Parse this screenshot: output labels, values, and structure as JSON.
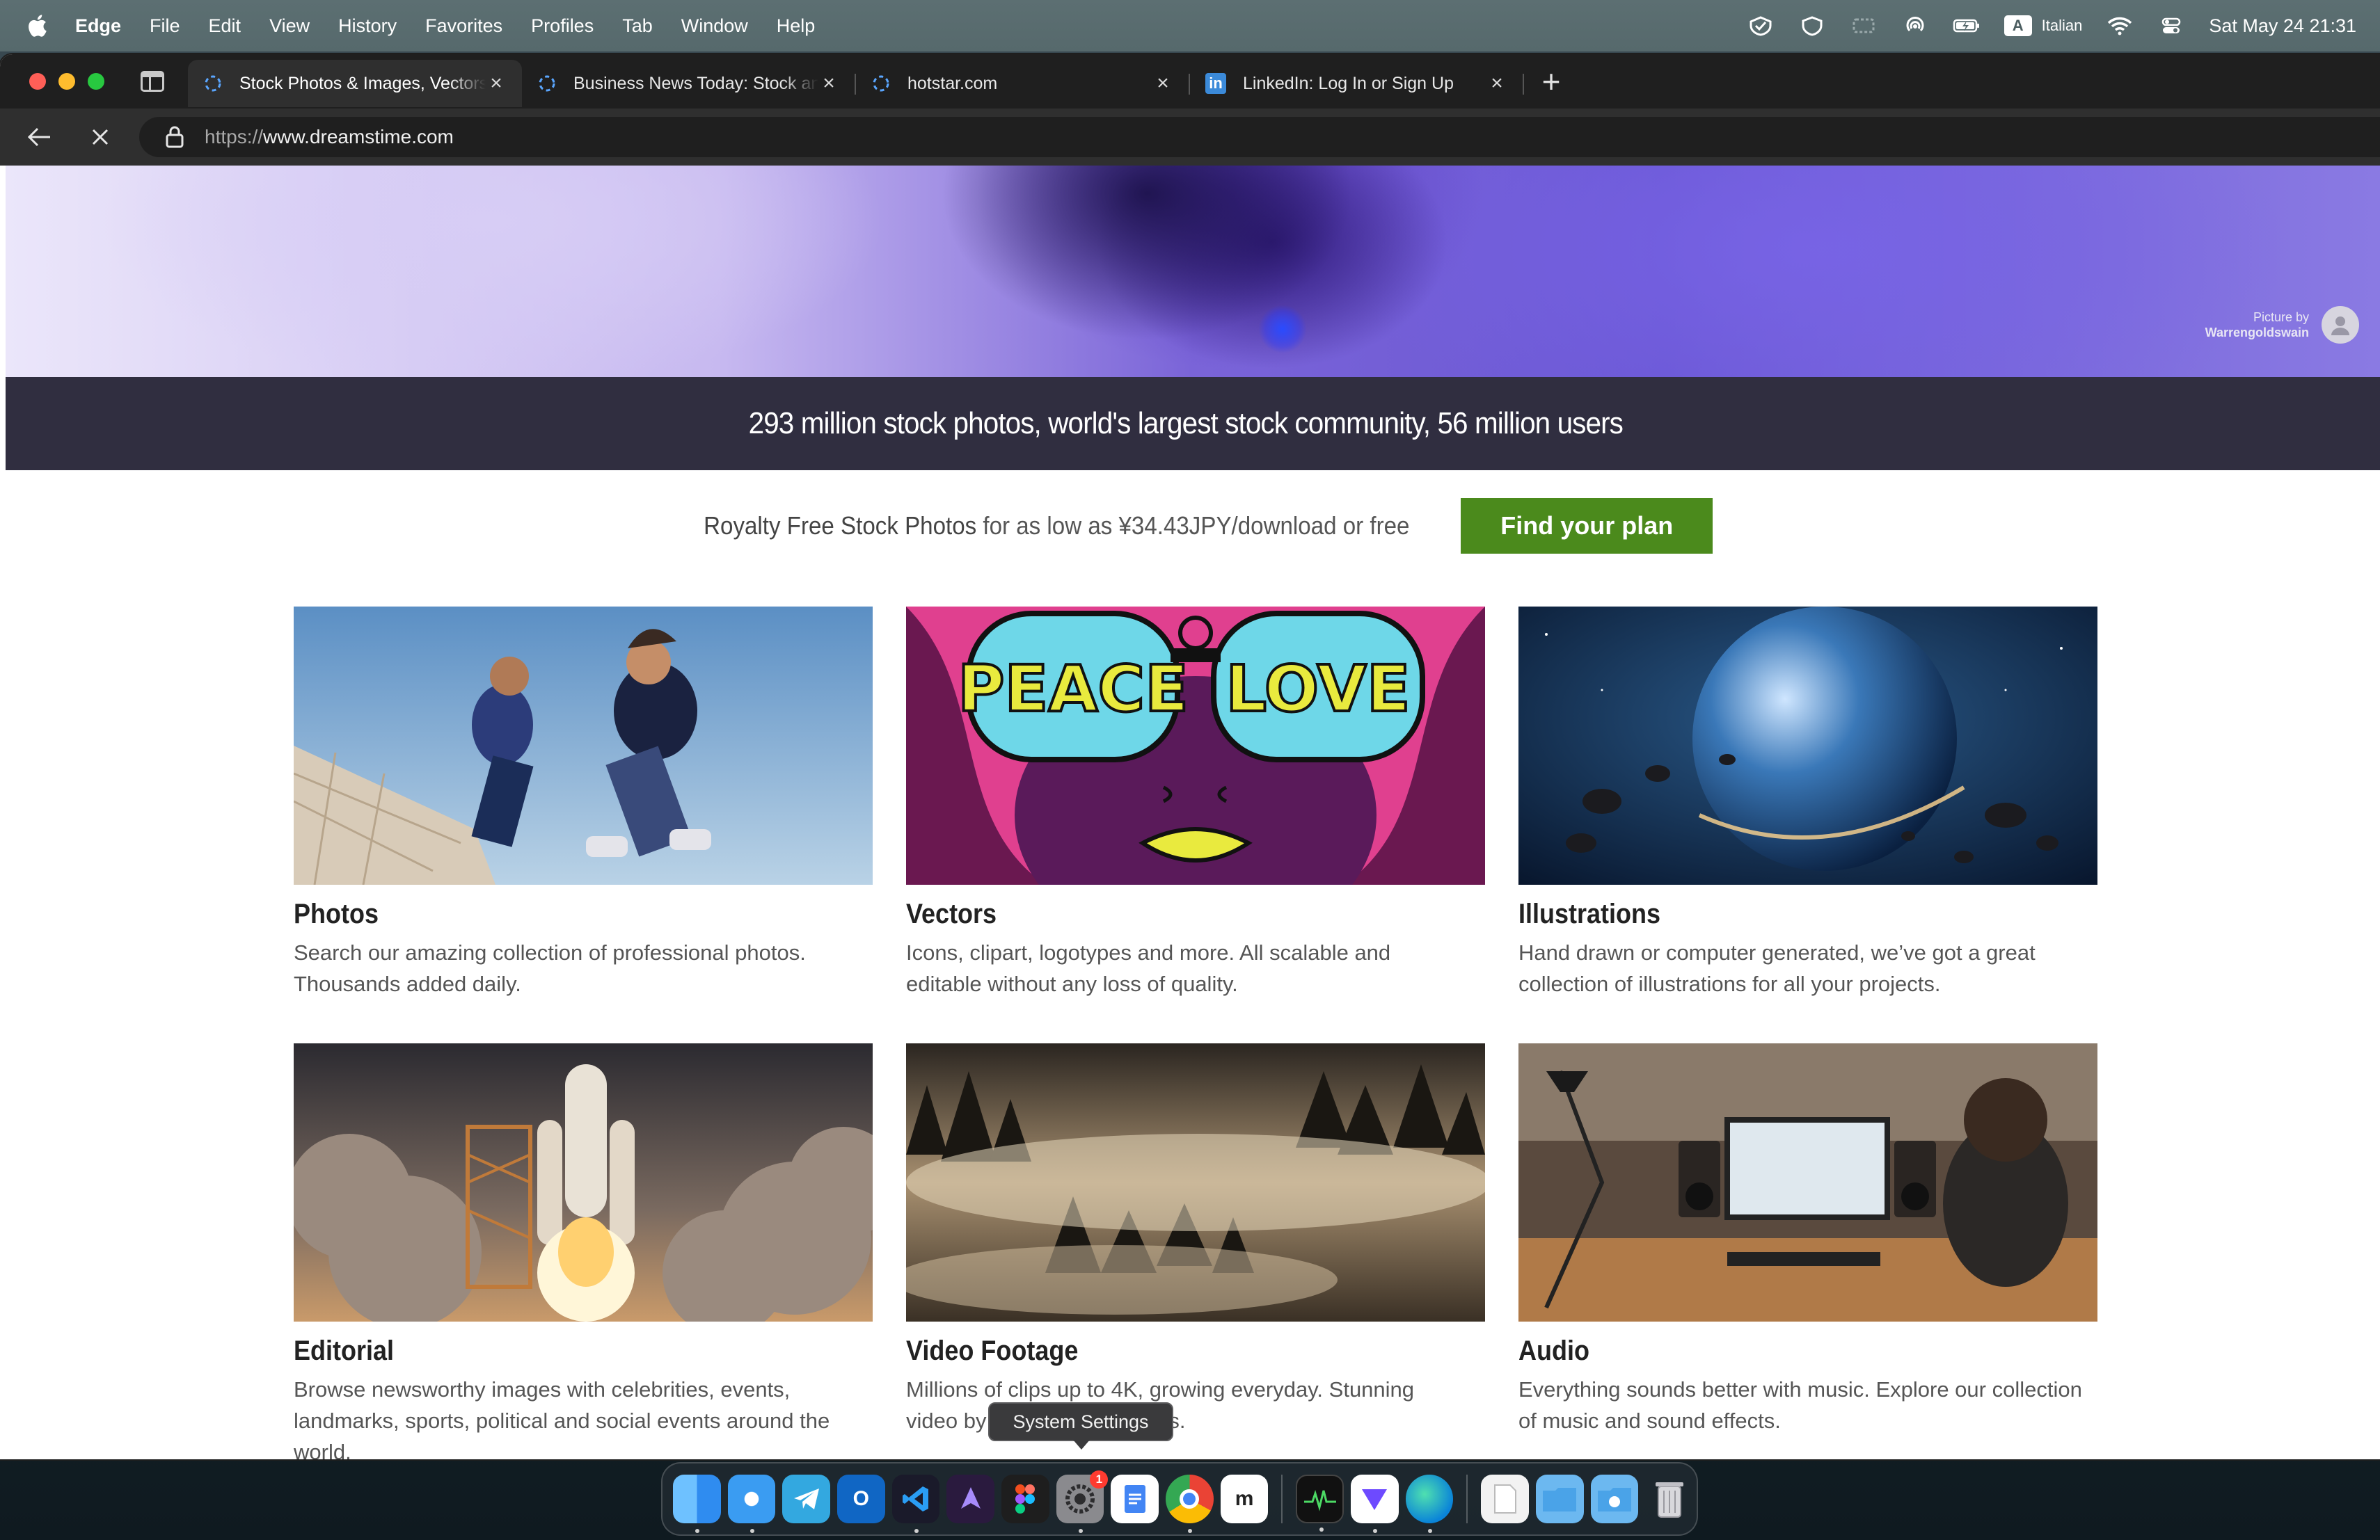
{
  "menubar": {
    "app_name": "Edge",
    "items": [
      "File",
      "Edit",
      "View",
      "History",
      "Favorites",
      "Profiles",
      "Tab",
      "Window",
      "Help"
    ],
    "input_source_badge": "A",
    "input_source": "Italian",
    "clock": "Sat May 24  21:31"
  },
  "browser": {
    "tabs": [
      {
        "title": "Stock Photos & Images, Vectors",
        "loading": true,
        "active": true
      },
      {
        "title": "Business News Today: Stock and",
        "loading": true,
        "active": false
      },
      {
        "title": "hotstar.com",
        "loading": true,
        "active": false
      },
      {
        "title": "LinkedIn: Log In or Sign Up",
        "icon": "in",
        "active": false
      }
    ],
    "close_glyph": "×",
    "newtab_glyph": "+",
    "url_scheme": "https://",
    "url_host": "www.dreamstime.com"
  },
  "hero": {
    "credit_label": "Picture by",
    "credit_name": "Warrengoldswain",
    "tagline": "293 million stock photos, world's largest stock community, 56 million users"
  },
  "cta": {
    "text_bold": "Royalty Free Stock Photos",
    "text_rest": " for as low as ¥34.43JPY/download or free",
    "button": "Find your plan",
    "button_color": "#4b8a1c"
  },
  "categories": [
    {
      "title": "Photos",
      "desc": "Search our amazing collection of professional photos. Thousands added daily."
    },
    {
      "title": "Vectors",
      "desc": "Icons, clipart, logotypes and more. All scalable and editable without any loss of quality."
    },
    {
      "title": "Illustrations",
      "desc": "Hand drawn or computer generated, we’ve got a great collection of illustrations for all your projects."
    },
    {
      "title": "Editorial",
      "desc": "Browse newsworthy images with celebrities, events, landmarks, sports, political and social events around the world."
    },
    {
      "title": "Video Footage",
      "desc": "Millions of clips up to 4K, growing everyday. Stunning video by talented filmmakers."
    },
    {
      "title": "Audio",
      "desc": "Everything sounds better with music. Explore our collection of music and sound effects."
    }
  ],
  "vector_art": {
    "left_word": "PEACE",
    "right_word": "LOVE"
  },
  "tooltip": "System Settings",
  "dock": {
    "items": [
      "finder-icon",
      "safari-icon",
      "telegram-icon",
      "outlook-icon",
      "vscode-icon",
      "perplexity-icon",
      "figma-icon",
      "system-settings-icon",
      "docs-icon",
      "chrome-icon",
      "miro-icon",
      "activity-monitor-icon",
      "proton-vpn-icon",
      "edge-icon",
      "file-icon",
      "folder-icon",
      "downloads-icon",
      "trash-icon"
    ],
    "system_settings_badge": "1"
  }
}
